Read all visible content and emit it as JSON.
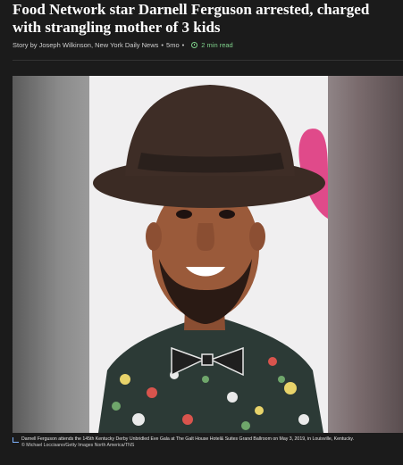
{
  "article": {
    "headline": "Food Network star Darnell Ferguson arrested, charged with strangling mother of 3 kids",
    "byline": {
      "author": "Story by Joseph Wilkinson, New York Daily News",
      "age": "5mo",
      "read_time": "2 min read"
    },
    "image": {
      "caption": "Darnell Ferguson attends the 145th Kentucky Derby Unbridled Eve Gala at The Galt House Hotel& Suites Grand Ballroom on May 3, 2019, in Louisville, Kentucky.",
      "credit": "© Michael Loccisano/Getty Images North America/TNS"
    }
  },
  "icons": {
    "clock": "clock-icon",
    "caption_marker": "caption-corner-icon"
  },
  "colors": {
    "background": "#1b1b1b",
    "accent_green": "#7fd18b",
    "hat": "#3b2b24"
  }
}
